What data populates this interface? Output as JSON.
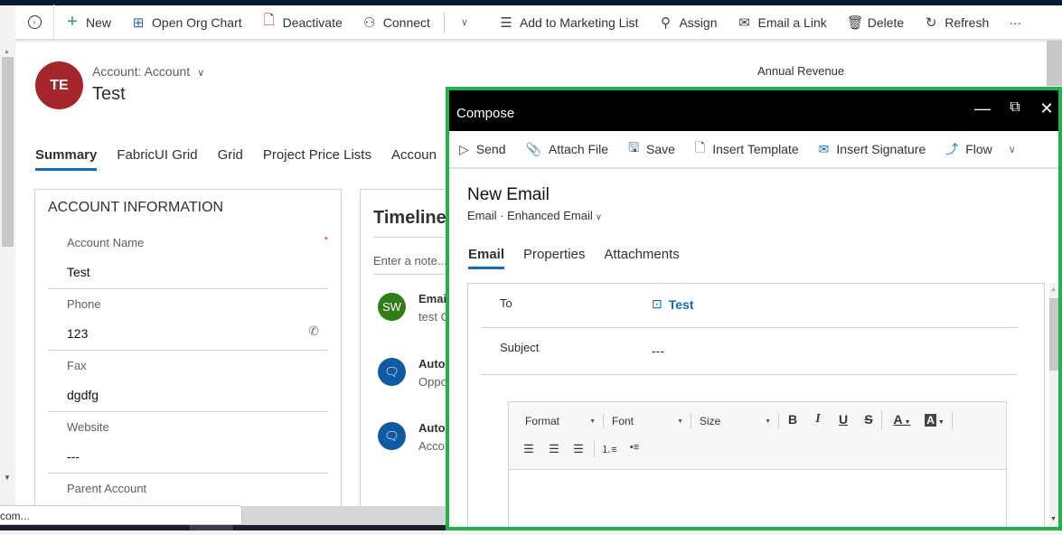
{
  "command_bar": {
    "items": [
      {
        "label": "New",
        "icon": "plus-icon"
      },
      {
        "label": "Open Org Chart",
        "icon": "org-chart-icon"
      },
      {
        "label": "Deactivate",
        "icon": "deactivate-icon"
      },
      {
        "label": "Connect",
        "icon": "connect-icon"
      },
      {
        "label": "Add to Marketing List",
        "icon": "add-list-icon"
      },
      {
        "label": "Assign",
        "icon": "assign-icon"
      },
      {
        "label": "Email a Link",
        "icon": "email-link-icon"
      },
      {
        "label": "Delete",
        "icon": "trash-icon"
      },
      {
        "label": "Refresh",
        "icon": "refresh-icon"
      }
    ],
    "more_label": "···"
  },
  "record": {
    "avatar_initials": "TE",
    "avatar_color": "#a4262c",
    "entity_type": "Account: Account",
    "name": "Test",
    "header_field_label": "Annual Revenue"
  },
  "tabs": [
    {
      "label": "Summary",
      "active": true
    },
    {
      "label": "FabricUI Grid",
      "active": false
    },
    {
      "label": "Grid",
      "active": false
    },
    {
      "label": "Project Price Lists",
      "active": false
    },
    {
      "label": "Accoun",
      "active": false
    }
  ],
  "account_info": {
    "title": "ACCOUNT INFORMATION",
    "fields": [
      {
        "label": "Account Name",
        "value": "Test",
        "required": "*"
      },
      {
        "label": "Phone",
        "value": "123"
      },
      {
        "label": "Fax",
        "value": "dgdfg"
      },
      {
        "label": "Website",
        "value": "---"
      },
      {
        "label": "Parent Account",
        "value": ""
      }
    ]
  },
  "timeline": {
    "title": "Timeline",
    "note_placeholder": "Enter a note...",
    "items": [
      {
        "badge": "SW",
        "badge_color": "#2e7d16",
        "title": "Emai",
        "subtitle": "test C"
      },
      {
        "badge": "",
        "badge_color": "#0f5ba3",
        "title": "Auto",
        "subtitle": "Oppo"
      },
      {
        "badge": "",
        "badge_color": "#0f5ba3",
        "title": "Auto",
        "subtitle": "Acco"
      }
    ]
  },
  "status_bar": {
    "url_text": "com..."
  },
  "compose": {
    "title": "Compose",
    "toolbar": [
      {
        "label": "Send",
        "icon": "send-icon"
      },
      {
        "label": "Attach File",
        "icon": "paperclip-icon"
      },
      {
        "label": "Save",
        "icon": "save-icon"
      },
      {
        "label": "Insert Template",
        "icon": "template-icon"
      },
      {
        "label": "Insert Signature",
        "icon": "signature-icon"
      },
      {
        "label": "Flow",
        "icon": "flow-icon"
      }
    ],
    "heading": "New Email",
    "subheading_entity": "Email",
    "subheading_form": "Enhanced Email",
    "tabs": [
      {
        "label": "Email",
        "active": true
      },
      {
        "label": "Properties",
        "active": false
      },
      {
        "label": "Attachments",
        "active": false
      }
    ],
    "to_label": "To",
    "to_value": "Test",
    "subject_label": "Subject",
    "subject_value": "---",
    "editor": {
      "format_label": "Format",
      "font_label": "Font",
      "size_label": "Size",
      "bold": "B",
      "italic": "I",
      "underline": "U",
      "strike": "S",
      "font_color": "A",
      "bg_color": "A"
    },
    "border_color": "#22b14c"
  }
}
